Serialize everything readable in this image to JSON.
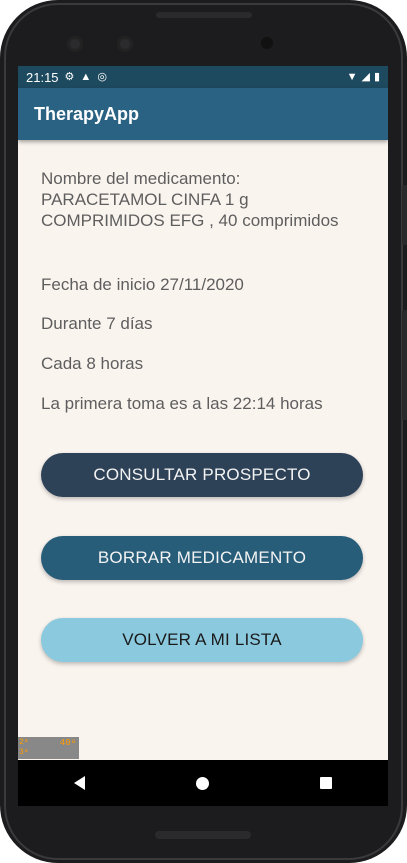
{
  "status_bar": {
    "time": "21:15",
    "left_icons": [
      "gear-icon",
      "warning-icon",
      "sync-icon"
    ],
    "right_icons": [
      "wifi-icon",
      "cell-signal-icon",
      "battery-icon"
    ]
  },
  "app_bar": {
    "title": "TherapyApp"
  },
  "medication": {
    "label": "Nombre del medicamento:",
    "name": "PARACETAMOL CINFA 1 g COMPRIMIDOS EFG , 40 comprimidos",
    "start_date": "Fecha de inicio 27/11/2020",
    "duration": "Durante 7 días",
    "frequency": "Cada 8 horas",
    "first_dose": "La primera toma es a las 22:14 horas"
  },
  "buttons": {
    "consult": "CONSULTAR PROSPECTO",
    "delete": "BORRAR MEDICAMENTO",
    "back_to_list": "VOLVER A MI LISTA"
  },
  "debug_overlay": {
    "line1": "2ᵃ",
    "line2": "3ᵃ",
    "value": "40ᵃ"
  },
  "nav_bar": {
    "icons": [
      "back-icon",
      "home-icon",
      "recents-icon"
    ]
  },
  "colors": {
    "status_bar": "#1e4a5f",
    "app_bar": "#2a6283",
    "background": "#faf4ef",
    "btn_consult": "#2d4157",
    "btn_delete": "#285d7a",
    "btn_back": "#8bc9df"
  }
}
